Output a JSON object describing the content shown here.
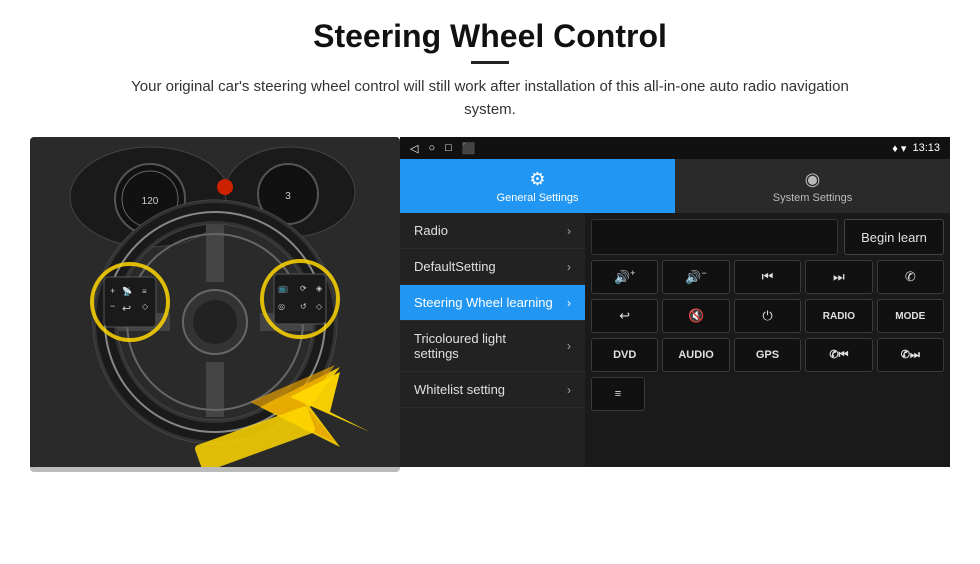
{
  "header": {
    "title": "Steering Wheel Control",
    "subtitle": "Your original car's steering wheel control will still work after installation of this all-in-one auto radio navigation system."
  },
  "statusBar": {
    "navIcons": [
      "◁",
      "○",
      "□",
      "⬛"
    ],
    "location": "♦ ▾",
    "time": "13:13"
  },
  "tabs": [
    {
      "id": "general",
      "icon": "⚙",
      "label": "General Settings",
      "active": true
    },
    {
      "id": "system",
      "icon": "◎",
      "label": "System Settings",
      "active": false
    }
  ],
  "menu": [
    {
      "id": "radio",
      "label": "Radio",
      "active": false
    },
    {
      "id": "default",
      "label": "DefaultSetting",
      "active": false
    },
    {
      "id": "steering",
      "label": "Steering Wheel learning",
      "active": true
    },
    {
      "id": "tricolour",
      "label": "Tricoloured light settings",
      "active": false
    },
    {
      "id": "whitelist",
      "label": "Whitelist setting",
      "active": false
    }
  ],
  "rightPanel": {
    "beginLearnLabel": "Begin learn",
    "buttons": [
      {
        "id": "vol-up",
        "icon": "🔊+",
        "display": "🔊+"
      },
      {
        "id": "vol-down",
        "icon": "🔊-",
        "display": "🔊−"
      },
      {
        "id": "prev",
        "icon": "⏮",
        "display": "⏮"
      },
      {
        "id": "next",
        "icon": "⏭",
        "display": "⏭"
      },
      {
        "id": "phone",
        "icon": "📞",
        "display": "✆"
      },
      {
        "id": "hang-up",
        "icon": "↩",
        "display": "↩"
      },
      {
        "id": "mute",
        "icon": "🔇",
        "display": "🔇"
      },
      {
        "id": "power",
        "icon": "⏻",
        "display": "⏻"
      },
      {
        "id": "radio",
        "icon": "RADIO",
        "display": "RADIO"
      },
      {
        "id": "mode",
        "icon": "MODE",
        "display": "MODE"
      }
    ],
    "bottomButtons": [
      {
        "id": "dvd",
        "label": "DVD"
      },
      {
        "id": "audio",
        "label": "AUDIO"
      },
      {
        "id": "gps",
        "label": "GPS"
      },
      {
        "id": "tel-prev",
        "label": "✆⏮"
      },
      {
        "id": "tel-next",
        "label": "✆⏭"
      }
    ],
    "extraButtons": [
      {
        "id": "list",
        "label": "≡"
      }
    ]
  }
}
